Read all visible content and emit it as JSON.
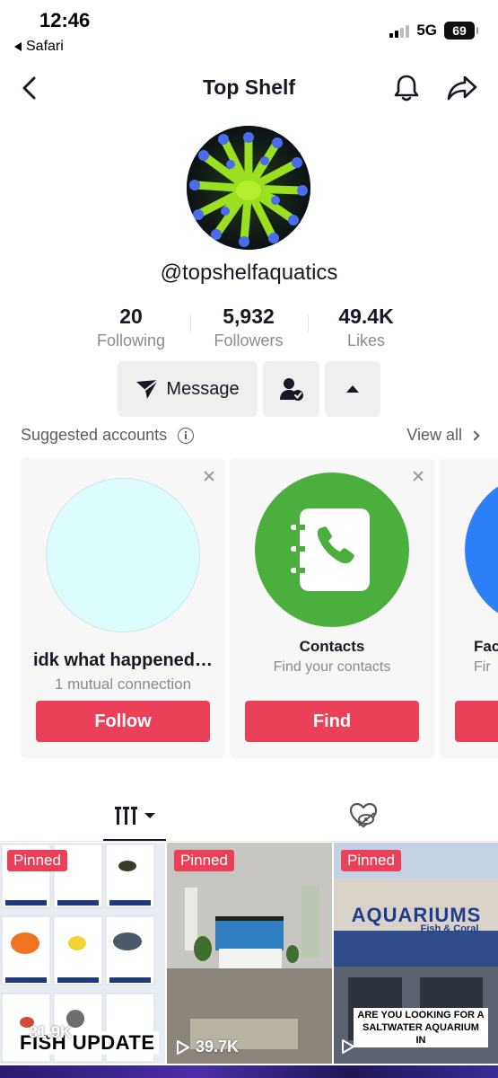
{
  "status_bar": {
    "time": "12:46",
    "back_app": "Safari",
    "network": "5G",
    "battery": "69"
  },
  "nav": {
    "title": "Top Shelf"
  },
  "profile": {
    "handle": "@topshelfaquatics",
    "stats": [
      {
        "value": "20",
        "label": "Following"
      },
      {
        "value": "5,932",
        "label": "Followers"
      },
      {
        "value": "49.4K",
        "label": "Likes"
      }
    ],
    "message_label": "Message"
  },
  "suggested": {
    "title": "Suggested accounts",
    "view_all": "View all",
    "cards": [
      {
        "name": "idk what happened…",
        "sub": "1 mutual connection",
        "cta": "Follow",
        "color": "#dcfcfc"
      },
      {
        "name": "Contacts",
        "sub": "Find your contacts",
        "cta": "Find",
        "color": "#4aaf3c"
      },
      {
        "name": "Fac",
        "sub": "Fir",
        "cta": "",
        "color": "#2d7ff9"
      }
    ]
  },
  "grid": {
    "videos": [
      {
        "pinned": "Pinned",
        "views": "31.9K",
        "caption": "FISH UPDATE"
      },
      {
        "pinned": "Pinned",
        "views": "39.7K",
        "caption": ""
      },
      {
        "pinned": "Pinned",
        "views": "",
        "caption": "ARE YOU LOOKING FOR A SALTWATER AQUARIUM IN",
        "sign_main": "AQUARIUMS",
        "sign_sub": "Fish & Coral"
      }
    ]
  },
  "colors": {
    "accent": "#ea4158",
    "text_primary": "#161823",
    "text_secondary": "#8a8b91"
  }
}
